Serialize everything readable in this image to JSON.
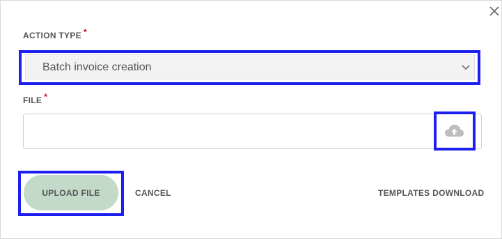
{
  "form": {
    "action_type_label": "ACTION TYPE",
    "required_mark": "*",
    "action_type_value": "Batch invoice creation",
    "file_label": "FILE",
    "file_value": ""
  },
  "actions": {
    "upload_label": "UPLOAD FILE",
    "cancel_label": "CANCEL",
    "templates_label": "TEMPLATES DOWNLOAD"
  },
  "icons": {
    "close": "close-icon",
    "dropdown": "chevron-down-icon",
    "upload": "cloud-upload-icon"
  },
  "colors": {
    "highlight": "#1d1ff0",
    "upload_button_bg": "#c3dac9",
    "required": "#d0021b"
  }
}
